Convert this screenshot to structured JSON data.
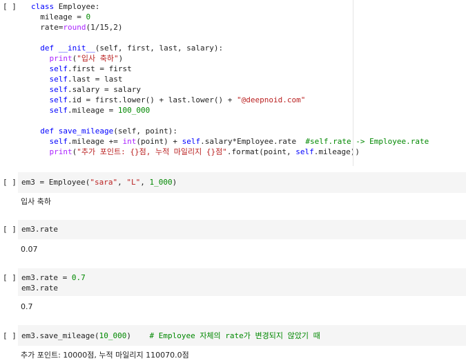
{
  "prompt": "[ ]",
  "cells": [
    {
      "lines": [
        [
          "class ",
          "Employee:"
        ],
        [
          "  mileage = ",
          "0"
        ],
        [
          "  rate=",
          "round",
          "(1/15,2)"
        ],
        [
          ""
        ],
        [
          "  def ",
          "__init__",
          "(self, first, last, salary):"
        ],
        [
          "    ",
          "print",
          "(",
          "\"입사 축하\"",
          ")"
        ],
        [
          "    ",
          "self",
          ".first = first"
        ],
        [
          "    ",
          "self",
          ".last = last"
        ],
        [
          "    ",
          "self",
          ".salary = salary"
        ],
        [
          "    ",
          "self",
          ".id = first.lower() + last.lower() + ",
          "\"@deepnoid.com\""
        ],
        [
          "    ",
          "self",
          ".mileage = ",
          "100_000"
        ],
        [
          ""
        ],
        [
          "  def ",
          "save_mileage",
          "(self, point):"
        ],
        [
          "    ",
          "self",
          ".mileage += ",
          "int",
          "(point) + ",
          "self",
          ".salary*Employee.rate  ",
          "#self.rate -> Employee.rate"
        ],
        [
          "    ",
          "print",
          "(",
          "\"추가 포인트: {}점, 누적 마일리지 {}점\"",
          ".format(point, ",
          "self",
          ".mileage))"
        ]
      ]
    },
    {
      "code": [
        "em3 = Employee(",
        "\"sara\"",
        ", ",
        "\"L\"",
        ", ",
        "1_000",
        ")"
      ],
      "output": "입사 축하"
    },
    {
      "code": "em3.rate",
      "output": "0.07"
    },
    {
      "code_line1": [
        "em3.rate = ",
        "0.7"
      ],
      "code_line2": "em3.rate",
      "output": "0.7"
    },
    {
      "code": [
        "em3.save_mileage(",
        "10_000",
        ")    ",
        "# Employee 자체의 rate가 변경되지 않았기 때"
      ],
      "output": "추가 포인트: 10000점, 누적 마일리지 110070.0점"
    }
  ]
}
